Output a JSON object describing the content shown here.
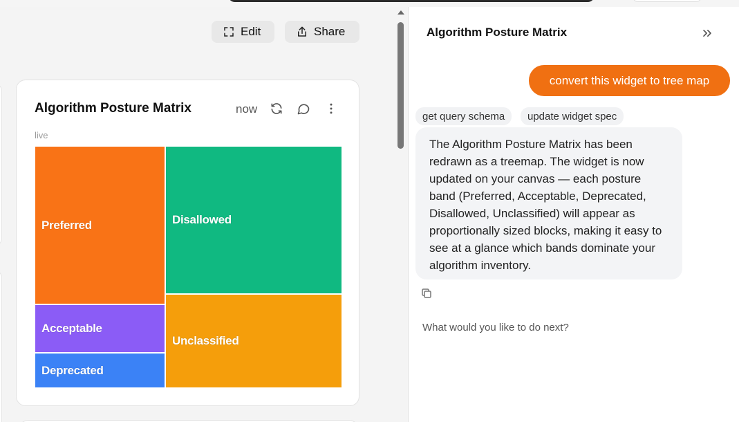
{
  "toolbar": {
    "edit_label": "Edit",
    "share_label": "Share"
  },
  "widget": {
    "title": "Algorithm Posture Matrix",
    "timestamp": "now",
    "status": "live",
    "chart_data": {
      "type": "treemap",
      "categories": [
        "Preferred",
        "Disallowed",
        "Unclassified",
        "Acceptable",
        "Deprecated"
      ],
      "colors": [
        "#f97316",
        "#10b981",
        "#f59e0b",
        "#8b5cf6",
        "#3b82f6"
      ]
    }
  },
  "panel": {
    "title": "Algorithm Posture Matrix",
    "user_message": "convert this widget to tree map",
    "tool_calls": [
      "get query schema",
      "update widget spec"
    ],
    "assistant_message": "The Algorithm Posture Matrix has been redrawn as a treemap. The widget is now updated on your canvas — each posture band (Preferred, Acceptable, Deprecated, Disallowed, Unclassified) will appear as proportionally sized blocks, making it easy to see at a glance which bands dominate your algorithm inventory.",
    "input_placeholder": "What would you like to do next?"
  },
  "icons": {
    "edit": "expand-icon",
    "share": "share-icon",
    "refresh": "refresh-icon",
    "comment": "comment-icon",
    "more": "more-vertical-icon",
    "collapse": "chevrons-right-icon",
    "copy": "copy-icon"
  }
}
